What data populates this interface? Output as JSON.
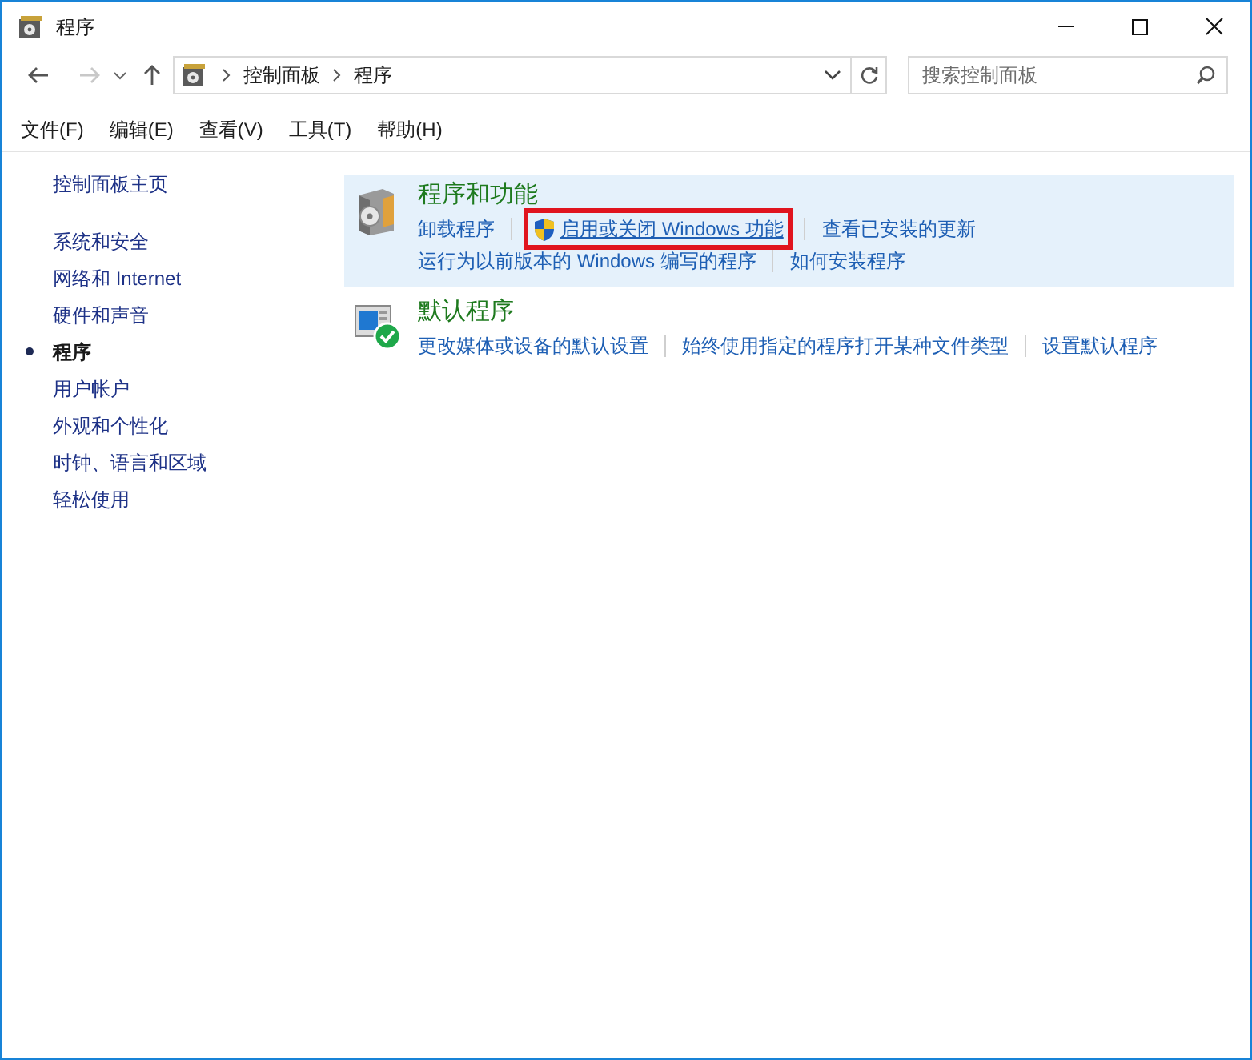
{
  "window": {
    "title": "程序"
  },
  "nav": {
    "path": [
      "控制面板",
      "程序"
    ],
    "search": {
      "placeholder": "搜索控制面板"
    }
  },
  "menu": [
    "文件(F)",
    "编辑(E)",
    "查看(V)",
    "工具(T)",
    "帮助(H)"
  ],
  "sidebar": {
    "home": "控制面板主页",
    "items": [
      {
        "label": "系统和安全",
        "selected": false
      },
      {
        "label": "网络和 Internet",
        "selected": false
      },
      {
        "label": "硬件和声音",
        "selected": false
      },
      {
        "label": "程序",
        "selected": true
      },
      {
        "label": "用户帐户",
        "selected": false
      },
      {
        "label": "外观和个性化",
        "selected": false
      },
      {
        "label": "时钟、语言和区域",
        "selected": false
      },
      {
        "label": "轻松使用",
        "selected": false
      }
    ]
  },
  "sections": [
    {
      "kind": "programs",
      "title": "程序和功能",
      "highlighted": true,
      "lines": [
        [
          {
            "label": "卸载程序",
            "shield": false,
            "outlined": false
          },
          {
            "label": "启用或关闭 Windows 功能",
            "shield": true,
            "outlined": true
          },
          {
            "label": "查看已安装的更新",
            "shield": false,
            "outlined": false
          }
        ],
        [
          {
            "label": "运行为以前版本的 Windows 编写的程序",
            "shield": false,
            "outlined": false
          },
          {
            "label": "如何安装程序",
            "shield": false,
            "outlined": false
          }
        ]
      ]
    },
    {
      "kind": "defaults",
      "title": "默认程序",
      "highlighted": false,
      "lines": [
        [
          {
            "label": "更改媒体或设备的默认设置",
            "shield": false,
            "outlined": false
          },
          {
            "label": "始终使用指定的程序打开某种文件类型",
            "shield": false,
            "outlined": false
          },
          {
            "label": "设置默认程序",
            "shield": false,
            "outlined": false
          }
        ]
      ]
    }
  ]
}
